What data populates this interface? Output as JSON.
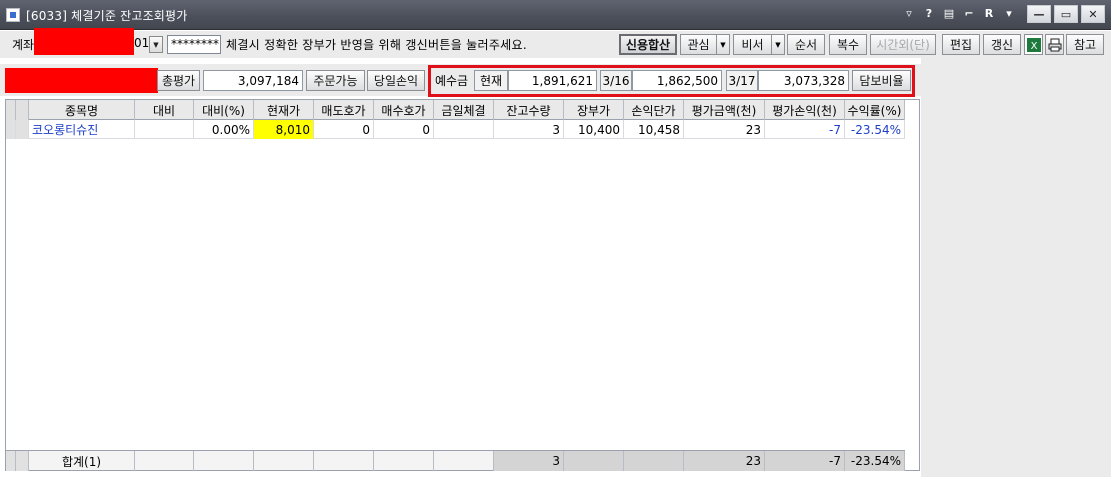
{
  "window": {
    "title": "[6033] 체결기준 잔고조회평가",
    "title_icons": [
      "pin-icon",
      "help-icon",
      "restore-icon",
      "pin2-icon",
      "r-icon",
      "menu-icon"
    ],
    "title_icon_glyphs": [
      "▿",
      "?",
      "▤",
      "⌐",
      "R",
      "▾"
    ],
    "controls": [
      "—",
      "▭",
      "✕"
    ]
  },
  "toolbar": {
    "account_label": "계좌",
    "account_suffix": "01",
    "password_value": "********",
    "notice": "체결시 정확한 장부가 반영을 위해 갱신버튼을 눌러주세요.",
    "buttons": {
      "credit_sum": "신용합산",
      "interest": "관심",
      "ratio": "비서",
      "order": "순서",
      "multiple": "복수",
      "after_hours": "시간외(단)",
      "edit": "편집",
      "refresh": "갱신",
      "reference": "참고"
    }
  },
  "summary": {
    "total_eval_label": "총평가",
    "total_eval_value": "3,097,184",
    "orderable_label": "주문가능",
    "daily_pnl_label": "당일손익",
    "deposit_label": "예수금",
    "current_label": "현재",
    "current_value": "1,891,621",
    "d1_label": "3/16",
    "d1_value": "1,862,500",
    "d2_label": "3/17",
    "d2_value": "3,073,328",
    "collateral_label": "담보비율"
  },
  "grid": {
    "headers": [
      "종목명",
      "대비",
      "대비(%)",
      "현재가",
      "매도호가",
      "매수호가",
      "금일체결",
      "잔고수량",
      "장부가",
      "손익단가",
      "평가금액(천)",
      "평가손익(천)",
      "수익률(%)"
    ],
    "rows": [
      {
        "name": "코오롱티슈진",
        "change": "",
        "change_pct": "0.00%",
        "price": "8,010",
        "ask": "0",
        "bid": "0",
        "today_exec": "",
        "qty": "3",
        "book_price": "10,400",
        "pnl_price": "10,458",
        "eval_amt": "23",
        "eval_pnl": "-7",
        "return_pct": "-23.54%"
      }
    ],
    "total": {
      "label": "합계(1)",
      "qty": "3",
      "eval_amt": "23",
      "eval_pnl": "-7",
      "return_pct": "-23.54%"
    }
  }
}
